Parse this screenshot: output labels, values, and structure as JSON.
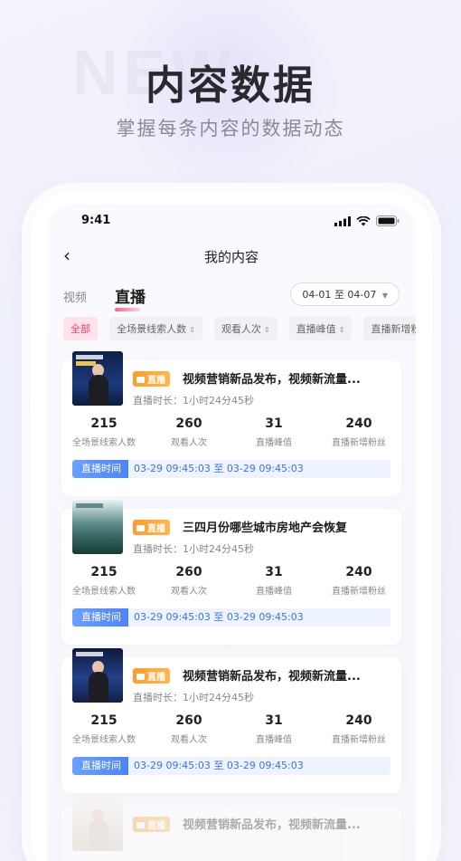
{
  "promo": {
    "title": "内容数据",
    "subtitle": "掌握每条内容的数据动态"
  },
  "status": {
    "time": "9:41"
  },
  "nav": {
    "title": "我的内容"
  },
  "tabs": [
    {
      "label": "视频"
    },
    {
      "label": "直播"
    }
  ],
  "date_range": "04-01 至 04-07",
  "filters": [
    {
      "label": "全部"
    },
    {
      "label": "全场景线索人数"
    },
    {
      "label": "观看人次"
    },
    {
      "label": "直播峰值"
    },
    {
      "label": "直播新增粉丝"
    }
  ],
  "cards": [
    {
      "badge": "直播",
      "title": "视频营销新品发布，视频新流量...",
      "duration": "直播时长：1小时24分45秒",
      "stats": [
        {
          "value": "215",
          "label": "全场景线索人数"
        },
        {
          "value": "260",
          "label": "观看人次"
        },
        {
          "value": "31",
          "label": "直播峰值"
        },
        {
          "value": "240",
          "label": "直播新增粉丝"
        }
      ],
      "time_label": "直播时间",
      "time_range": "03-29 09:45:03 至 03-29 09:45:03"
    },
    {
      "badge": "直播",
      "title": "三四月份哪些城市房地产会恢复",
      "duration": "直播时长：1小时24分45秒",
      "stats": [
        {
          "value": "215",
          "label": "全场景线索人数"
        },
        {
          "value": "260",
          "label": "观看人次"
        },
        {
          "value": "31",
          "label": "直播峰值"
        },
        {
          "value": "240",
          "label": "直播新增粉丝"
        }
      ],
      "time_label": "直播时间",
      "time_range": "03-29 09:45:03 至 03-29 09:45:03"
    },
    {
      "badge": "直播",
      "title": "视频营销新品发布，视频新流量...",
      "duration": "直播时长：1小时24分45秒",
      "stats": [
        {
          "value": "215",
          "label": "全场景线索人数"
        },
        {
          "value": "260",
          "label": "观看人次"
        },
        {
          "value": "31",
          "label": "直播峰值"
        },
        {
          "value": "240",
          "label": "直播新增粉丝"
        }
      ],
      "time_label": "直播时间",
      "time_range": "03-29 09:45:03 至 03-29 09:45:03"
    },
    {
      "badge": "直播",
      "title": "视频营销新品发布，视频新流量..."
    }
  ]
}
